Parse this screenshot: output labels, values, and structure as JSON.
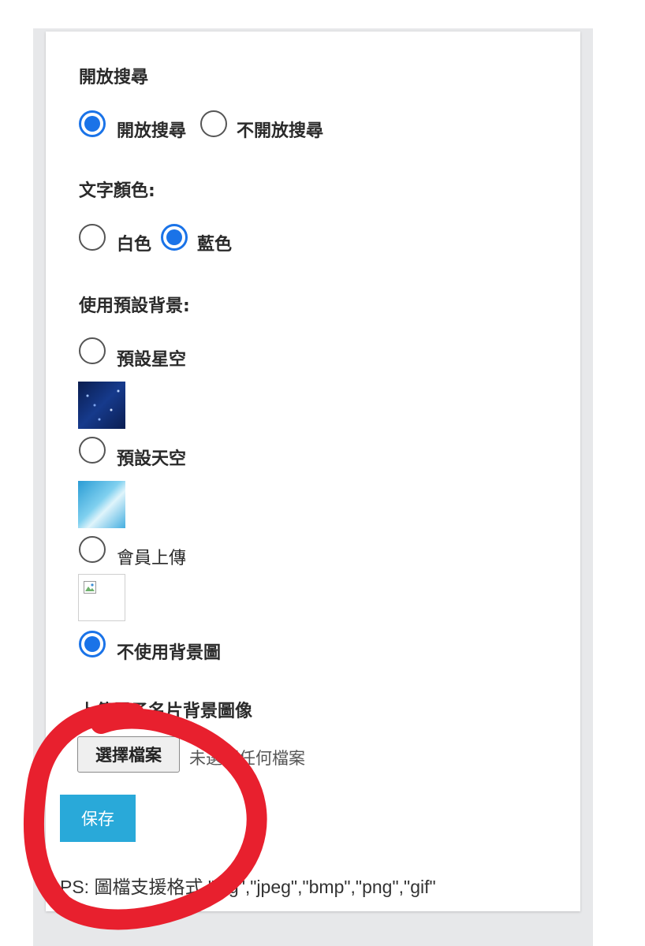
{
  "search": {
    "title": "開放搜尋",
    "options": [
      {
        "label": "開放搜尋",
        "checked": true
      },
      {
        "label": "不開放搜尋",
        "checked": false
      }
    ]
  },
  "text_color": {
    "title": "文字顏色:",
    "options": [
      {
        "label": "白色",
        "checked": false
      },
      {
        "label": "藍色",
        "checked": true
      }
    ]
  },
  "background": {
    "title": "使用預設背景:",
    "options": [
      {
        "label": "預設星空",
        "checked": false
      },
      {
        "label": "預設天空",
        "checked": false
      },
      {
        "label": "會員上傳",
        "checked": false
      },
      {
        "label": "不使用背景圖",
        "checked": true
      }
    ]
  },
  "upload": {
    "title": "上傳電子名片背景圖像",
    "choose_button": "選擇檔案",
    "no_file_text": "未選擇任何檔案"
  },
  "save_button": "保存",
  "ps_note": "PS: 圖檔支援格式 \"jpg\",\"jpeg\",\"bmp\",\"png\",\"gif\"",
  "colors": {
    "radio_checked": "#1a73e8",
    "save_button_bg": "#29a9d9",
    "annotation": "#e8202e"
  }
}
